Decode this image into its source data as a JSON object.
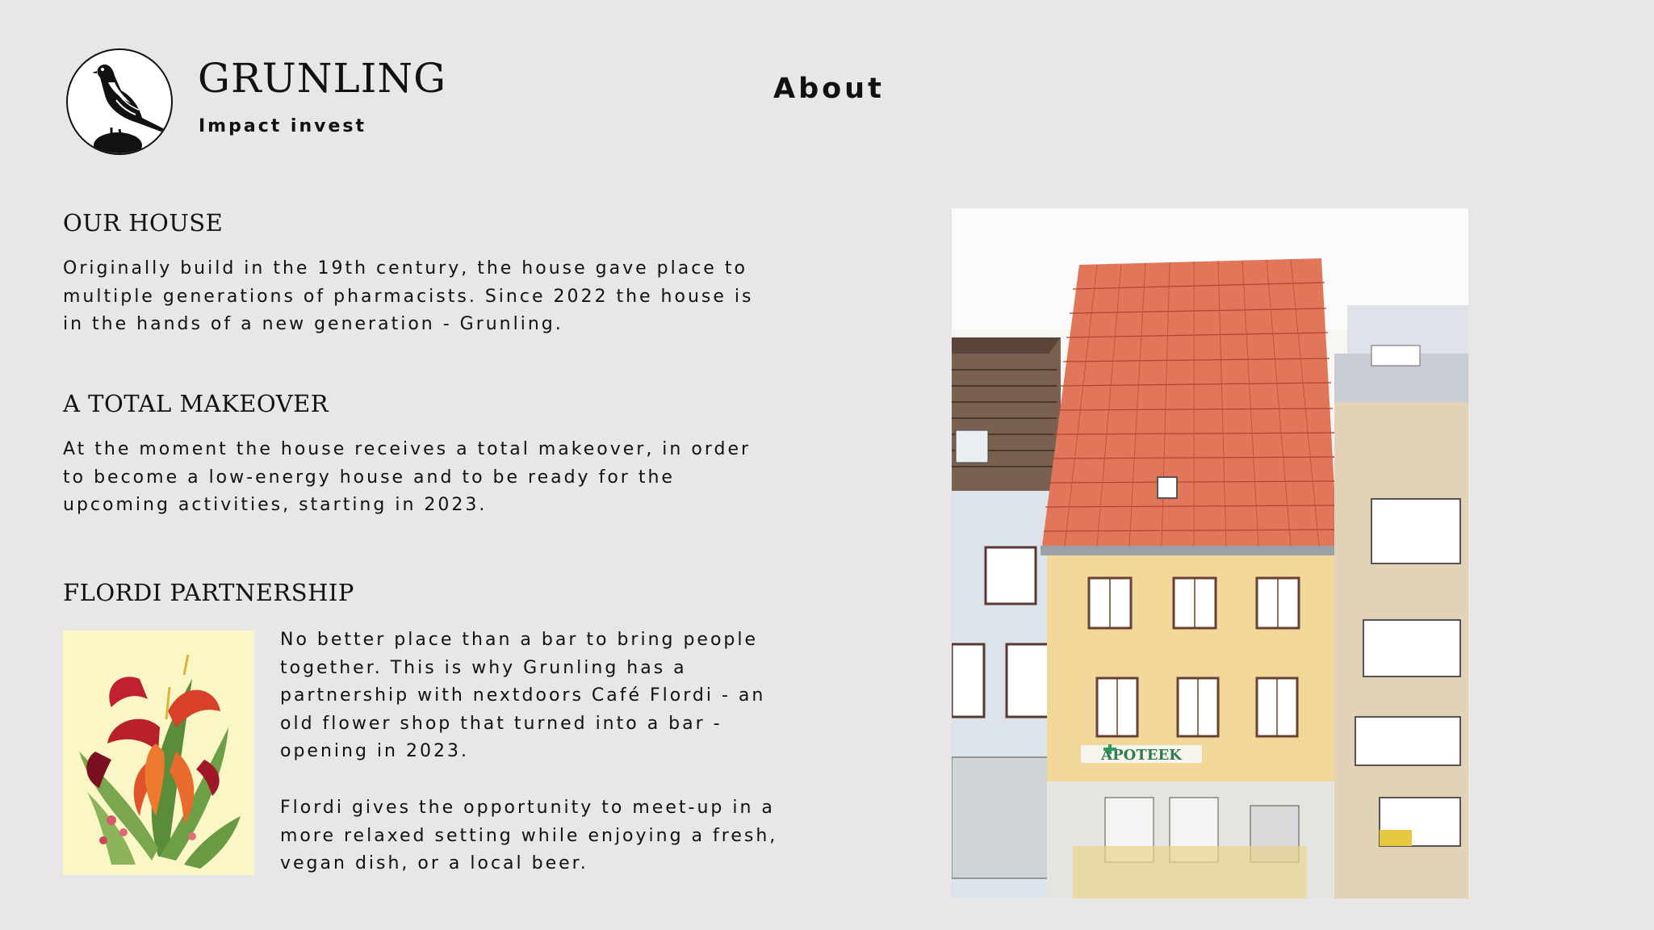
{
  "header": {
    "brand_title": "GRUNLING",
    "brand_subtitle": "Impact invest",
    "logo_icon": "sparrow-logo-icon",
    "nav_about": "About"
  },
  "sections": {
    "house": {
      "heading": "OUR HOUSE",
      "text": "Originally build in the 19th century, the house gave place to multiple generations of pharmacists. Since 2022 the house is in the hands of a new generation - Grunling."
    },
    "makeover": {
      "heading": "A TOTAL MAKEOVER",
      "text": "At the moment the house receives a total makeover, in order to become a low-energy house and to be ready for the upcoming activities, starting in 2023."
    },
    "flordi": {
      "heading": "FLORDI PARTNERSHIP",
      "text1": "No better place than a bar to bring people together. This is why Grunling has a partnership with nextdoors Café Flordi - an old flower shop that turned into a bar - opening in 2023.",
      "text2": "Flordi gives the opportunity to meet-up  in a more relaxed setting while enjoying a fresh, vegan dish, or a local beer."
    }
  },
  "images": {
    "house_sign": "APOTEEK"
  },
  "colors": {
    "background": "#e8e6e7",
    "text": "#111111",
    "roof": "#e2765a",
    "facade": "#f2d79a"
  }
}
